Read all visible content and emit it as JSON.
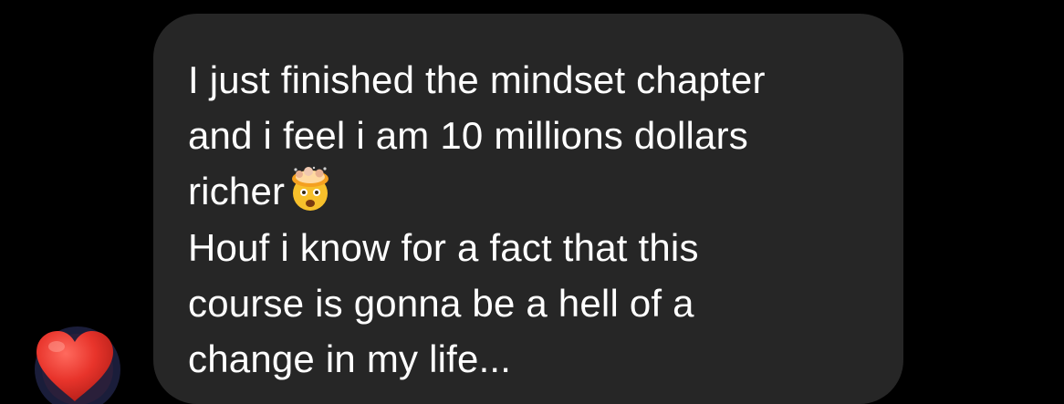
{
  "message": {
    "lines": [
      "I just finished the mindset chapter",
      "and i feel i am 10 millions dollars",
      "richer",
      "Houf i know for a fact that this",
      "course is gonna be a hell of a",
      "change in my life..."
    ],
    "inline_emoji": "exploding-head-emoji"
  },
  "reaction": {
    "icon": "heart-icon",
    "color": "#e8342b"
  },
  "colors": {
    "background": "#000000",
    "bubble": "#262626",
    "text": "#ffffff"
  }
}
